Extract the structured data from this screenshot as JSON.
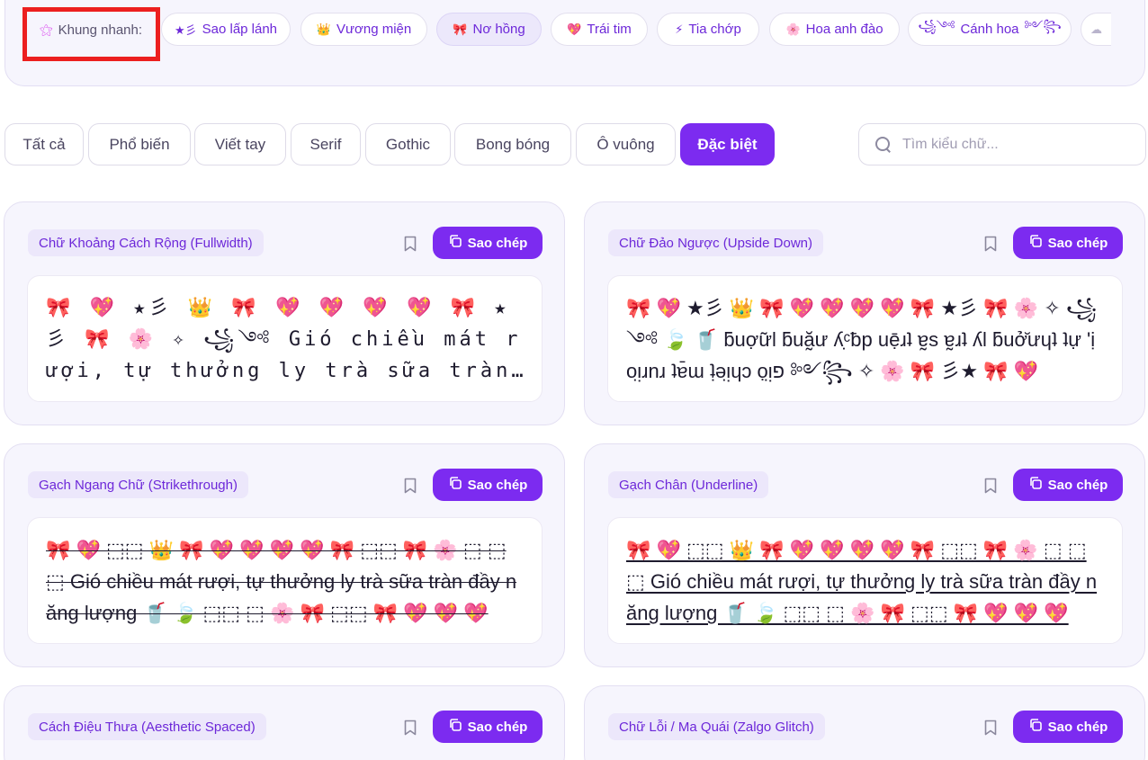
{
  "quick_frames": {
    "label": "Khung nhanh:",
    "chips": [
      {
        "icon": "★彡",
        "label": "Sao lấp lánh",
        "active": false
      },
      {
        "icon": "👑",
        "label": "Vương miện",
        "active": false
      },
      {
        "icon": "🎀",
        "label": "Nơ hồng",
        "active": true
      },
      {
        "icon": "💖",
        "label": "Trái tim",
        "active": false
      },
      {
        "icon": "⚡",
        "label": "Tia chớp",
        "active": false
      },
      {
        "icon": "🌸",
        "label": "Hoa anh đào",
        "active": false
      },
      {
        "icon": "꧁༺",
        "label": "Cánh hoa",
        "suffix": "༻꧂",
        "active": false
      },
      {
        "icon": "☁",
        "label": "",
        "active": false
      }
    ]
  },
  "categories": {
    "tabs": [
      "Tất cả",
      "Phổ biến",
      "Viết tay",
      "Serif",
      "Gothic",
      "Bong bóng",
      "Ô vuông",
      "Đặc biệt"
    ],
    "active": "Đặc biệt"
  },
  "search": {
    "placeholder": "Tìm kiểu chữ..."
  },
  "cards": [
    {
      "name": "Chữ Khoảng Cách Rộng (Fullwidth)",
      "copy_label": "Sao chép",
      "preview": "🎀 💖 ★彡 👑 🎀 💖 💖 💖 💖 🎀 ★彡 🎀 🌸 ✧ ꧁༺ Gió chiều mát rượi, tự thưởng ly trà sữa tràn đầy năng lượng"
    },
    {
      "name": "Chữ Đảo Ngược (Upside Down)",
      "copy_label": "Sao chép",
      "preview": "🎀 💖 ★彡 👑 🎀 💖 💖 💖 💖 🎀 ★彡 🎀 🌸 ✧ ꧁༺ 🍃 🥤 ƃuợư͂l ƃuă̰ư ʎᶜ̣ƀp uẹ̄ɹʇ ɐ̰s ɐ̰ɹʇ ʎl ƃuở̆ưɥʇ ʇự 'ịoᴉ̣ɹnɹ ʇɐ̄ɯ ʇ̣ǝᴉ̣ɥɔ ọᴉ̣פ ༻꧂ ✧ 🌸 🎀 彡★ 🎀 💖"
    },
    {
      "name": "Gạch Ngang Chữ (Strikethrough)",
      "copy_label": "Sao chép",
      "preview": "🎀 💖 ⬚⬚ 👑 🎀 💖 💖 💖 💖 🎀 ⬚⬚ 🎀 🌸 ⬚ ⬚⬚ Gió chiều mát rượi, tự thưởng ly trà sữa tràn đầy năng lượng 🥤 🍃 ⬚⬚ ⬚ 🌸 🎀 ⬚⬚ 🎀 💖 💖 💖"
    },
    {
      "name": "Gạch Chân (Underline)",
      "copy_label": "Sao chép",
      "preview": "🎀 💖 ⬚⬚ 👑 🎀 💖 💖 💖 💖 🎀 ⬚⬚ 🎀 🌸 ⬚ ⬚⬚ Gió chiều mát rượi, tự thưởng ly trà sữa tràn đầy năng lượng 🥤 🍃 ⬚⬚ ⬚ 🌸 🎀 ⬚⬚ 🎀 💖 💖 💖"
    },
    {
      "name": "Cách Điệu Thưa (Aesthetic Spaced)",
      "copy_label": "Sao chép",
      "preview": ""
    },
    {
      "name": "Chữ Lỗi / Ma Quái (Zalgo Glitch)",
      "copy_label": "Sao chép",
      "preview": ""
    }
  ]
}
